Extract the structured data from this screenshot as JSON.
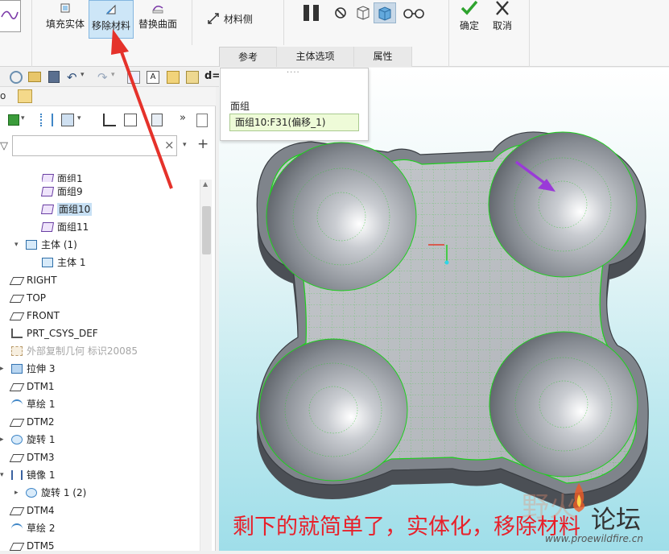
{
  "ribbon": {
    "fill_solid": "填充实体",
    "remove_material": "移除材料",
    "replace_surface": "替换曲面",
    "material_side": "材料侧",
    "confirm": "确定",
    "cancel": "取消"
  },
  "sub_tabs": [
    "参考",
    "主体选项",
    "属性"
  ],
  "popup": {
    "label": "面组",
    "value": "面组10:F31(偏移_1)",
    "grip": "····"
  },
  "tree": [
    {
      "label": "面组1",
      "icon": "quilt-icon"
    },
    {
      "label": "面组9",
      "icon": "quilt-icon"
    },
    {
      "label": "面组10",
      "icon": "quilt-icon",
      "selected": true
    },
    {
      "label": "面组11",
      "icon": "quilt-icon"
    },
    {
      "label": "主体 (1)",
      "icon": "body-icon"
    },
    {
      "label": "主体 1",
      "icon": "body-icon"
    },
    {
      "label": "RIGHT",
      "icon": "datum-plane-icon"
    },
    {
      "label": "TOP",
      "icon": "datum-plane-icon"
    },
    {
      "label": "FRONT",
      "icon": "datum-plane-icon"
    },
    {
      "label": "PRT_CSYS_DEF",
      "icon": "csys-icon"
    },
    {
      "label": "外部复制几何 标识20085",
      "icon": "copy-geom-icon",
      "muted": true
    },
    {
      "label": "拉伸 3",
      "icon": "extrude-icon"
    },
    {
      "label": "DTM1",
      "icon": "datum-plane-icon"
    },
    {
      "label": "草绘 1",
      "icon": "sketch-icon"
    },
    {
      "label": "DTM2",
      "icon": "datum-plane-icon"
    },
    {
      "label": "旋转 1",
      "icon": "revolve-icon"
    },
    {
      "label": "DTM3",
      "icon": "datum-plane-icon"
    },
    {
      "label": "镜像 1",
      "icon": "mirror-icon"
    },
    {
      "label": "旋转 1 (2)",
      "icon": "revolve-icon"
    },
    {
      "label": "DTM4",
      "icon": "datum-plane-icon"
    },
    {
      "label": "草绘 2",
      "icon": "sketch-icon"
    },
    {
      "label": "DTM5",
      "icon": "datum-plane-icon"
    }
  ],
  "toolbar": {
    "d_label": "d="
  },
  "filter": {
    "clear": "×",
    "add": "+"
  },
  "caption": "剩下的就简单了，实体化，移除材料",
  "watermark": {
    "logo_text": "野火",
    "forum": "论坛",
    "url": "www.proewildfire.cn"
  },
  "colors": {
    "accent_blue": "#3f86c7",
    "caption_red": "#e8202a",
    "arrow_red": "#e5322b",
    "arrow_purple": "#9a3ad8",
    "model_green": "#1fcf1f",
    "model_gray": "#8d9298"
  }
}
